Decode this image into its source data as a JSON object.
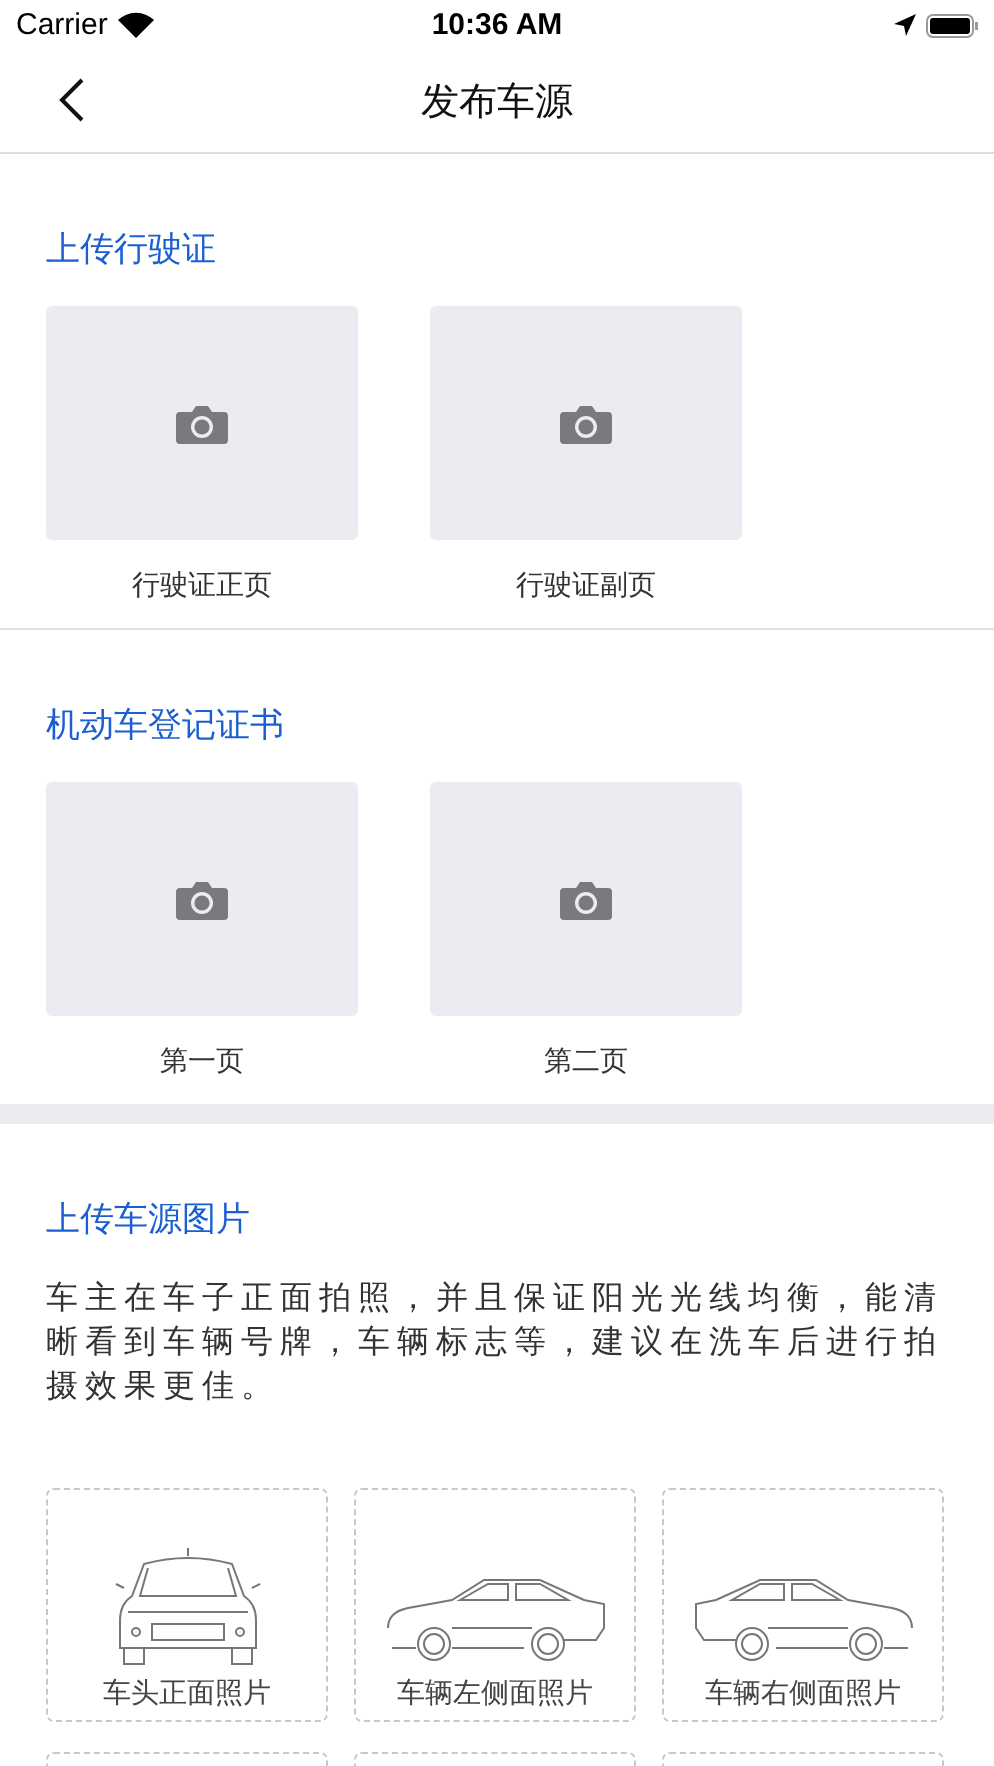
{
  "status_bar": {
    "carrier": "Carrier",
    "time": "10:36 AM"
  },
  "nav": {
    "title": "发布车源"
  },
  "sections": [
    {
      "title": "上传行驶证",
      "slots": [
        {
          "label": "行驶证正页"
        },
        {
          "label": "行驶证副页"
        }
      ]
    },
    {
      "title": "机动车登记证书",
      "slots": [
        {
          "label": "第一页"
        },
        {
          "label": "第二页"
        }
      ]
    }
  ],
  "vehicle_photos": {
    "title": "上传车源图片",
    "description": "车主在车子正面拍照，并且保证阳光光线均衡，能清晰看到车辆号牌，车辆标志等，建议在洗车后进行拍摄效果更佳。",
    "slots": [
      {
        "kind": "front",
        "label": "车头正面照片"
      },
      {
        "kind": "left",
        "label": "车辆左侧面照片"
      },
      {
        "kind": "right",
        "label": "车辆右侧面照片"
      },
      {
        "kind": "hidden"
      },
      {
        "kind": "hidden"
      },
      {
        "kind": "hidden"
      }
    ]
  }
}
